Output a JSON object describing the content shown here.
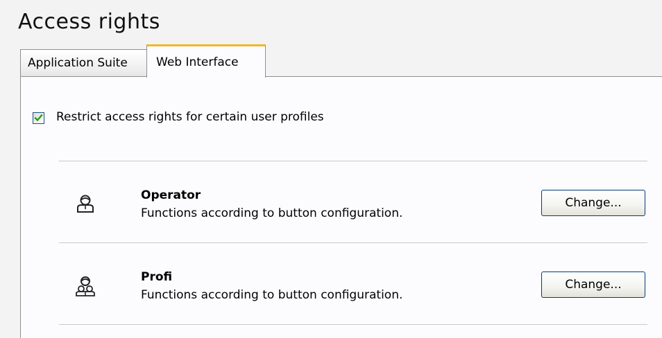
{
  "page": {
    "title": "Access rights"
  },
  "tabs": [
    {
      "label": "Application Suite",
      "active": false
    },
    {
      "label": "Web Interface",
      "active": true
    }
  ],
  "restrict": {
    "checked": true,
    "label": "Restrict access rights for certain user profiles"
  },
  "profiles": [
    {
      "name": "Operator",
      "description": "Functions according to button configuration.",
      "icon": "user-icon",
      "button_label": "Change..."
    },
    {
      "name": "Profi",
      "description": "Functions according to button configuration.",
      "icon": "users-group-icon",
      "button_label": "Change..."
    }
  ],
  "colors": {
    "active_tab_accent": "#f3b727",
    "check_mark": "#21a121",
    "button_border": "#003c74"
  }
}
